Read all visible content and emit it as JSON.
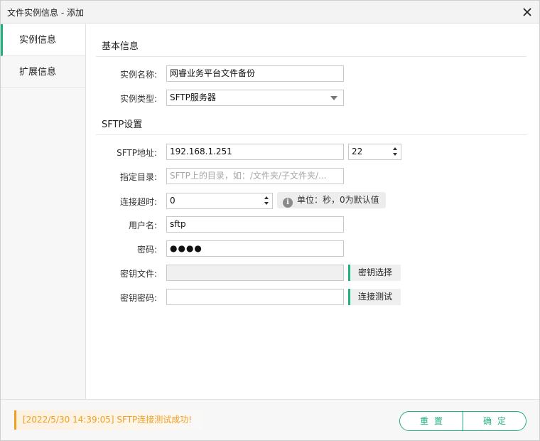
{
  "window": {
    "title": "文件实例信息 - 添加"
  },
  "sidebar": {
    "items": [
      {
        "label": "实例信息",
        "active": true
      },
      {
        "label": "扩展信息",
        "active": false
      }
    ]
  },
  "basic": {
    "title": "基本信息",
    "name_label": "实例名称:",
    "name_value": "网睿业务平台文件备份",
    "type_label": "实例类型:",
    "type_value": "SFTP服务器"
  },
  "sftp": {
    "title": "SFTP设置",
    "address_label": "SFTP地址:",
    "address_value": "192.168.1.251",
    "port_value": "22",
    "dir_label": "指定目录:",
    "dir_placeholder": "SFTP上的目录，如：/文件夹/子文件夹/...",
    "timeout_label": "连接超时:",
    "timeout_value": "0",
    "timeout_hint": "单位：秒，0为默认值",
    "user_label": "用户名:",
    "user_value": "sftp",
    "password_label": "密码:",
    "password_value": "●●●●",
    "keyfile_label": "密钥文件:",
    "keyfile_value": "",
    "keyfile_button": "密钥选择",
    "keypass_label": "密钥密码:",
    "keypass_value": "",
    "test_button": "连接测试"
  },
  "footer": {
    "status": "[2022/5/30  14:39:05]  SFTP连接测试成功!",
    "reset_label": "重置",
    "ok_label": "确定"
  },
  "colors": {
    "accent": "#22b07d",
    "warning": "#f0a020"
  },
  "icons": {
    "close": "close-icon",
    "hint": "info-icon",
    "dropdown": "chevron-down-icon",
    "spinner": "spinner-arrows-icon"
  }
}
